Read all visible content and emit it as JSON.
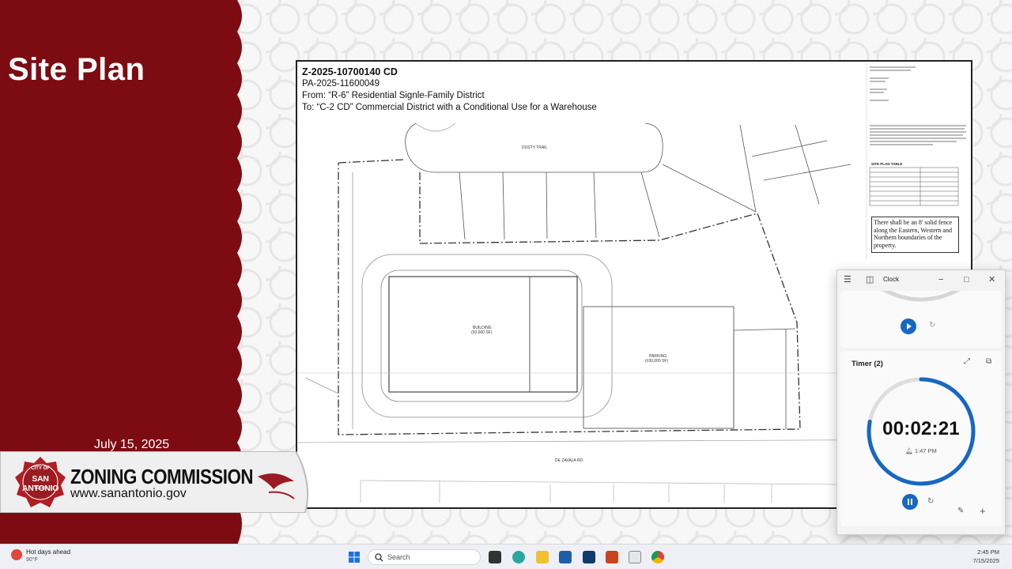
{
  "slide": {
    "title": "Site Plan",
    "date": "July 15, 2025",
    "accent_color": "#7d0c12"
  },
  "drawing": {
    "case_number": "Z-2025-10700140 CD",
    "pa_number": "PA-2025-11600049",
    "from_line": "From: “R-6” Residential Signle-Family District",
    "to_line": "To: “C-2 CD” Commercial District with a Conditional Use for a Warehouse",
    "street_north": "DUSTY TRAIL",
    "street_south": "DE ZAVALA RD",
    "building_label": "BUILDING",
    "building_area": "(50,000 SF)",
    "parking_label": "PARKING",
    "parking_area": "(±30,000 SF)",
    "site_plan_table_title": "SITE PLAN TABLE",
    "fence_note": "There shall be an 8' solid fence along the Eastern, Western and Northern boundaries of the property."
  },
  "banner": {
    "seal_top": "CITY OF",
    "seal_name": "SAN ANTONIO",
    "seal_bottom": "TEXAS",
    "commission_name": "ZONING COMMISSION",
    "url": "www.sanantonio.gov"
  },
  "clock_app": {
    "title": "Clock",
    "timer_name": "Timer (2)",
    "time_remaining": "00:02:21",
    "end_time": "1:47 PM",
    "timer_progress": 0.78,
    "accent_color": "#1668c1"
  },
  "taskbar": {
    "weather_title": "Hot days ahead",
    "weather_temp": "90°F",
    "search_placeholder": "Search",
    "time": "2:45 PM",
    "date": "7/15/2025"
  }
}
